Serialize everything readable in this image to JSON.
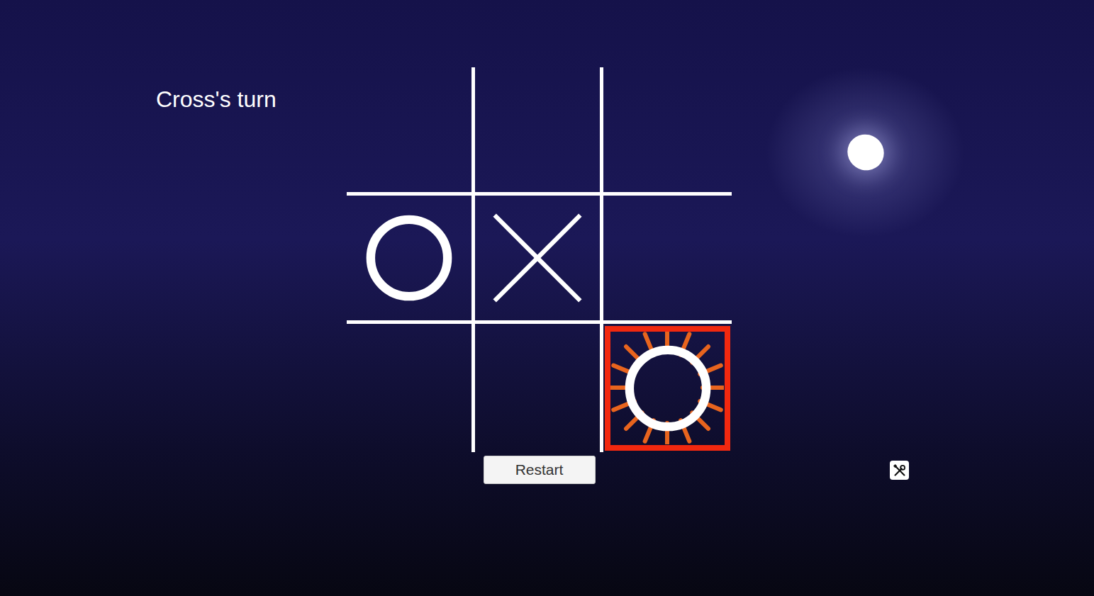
{
  "status": "Cross's turn",
  "board": [
    {
      "kind": "empty",
      "selected": false
    },
    {
      "kind": "empty",
      "selected": false
    },
    {
      "kind": "empty",
      "selected": false
    },
    {
      "kind": "nought",
      "selected": false
    },
    {
      "kind": "cross",
      "selected": false
    },
    {
      "kind": "empty",
      "selected": false
    },
    {
      "kind": "empty",
      "selected": false
    },
    {
      "kind": "empty",
      "selected": false
    },
    {
      "kind": "nought",
      "selected": true
    }
  ],
  "restart": {
    "label": "Restart"
  }
}
